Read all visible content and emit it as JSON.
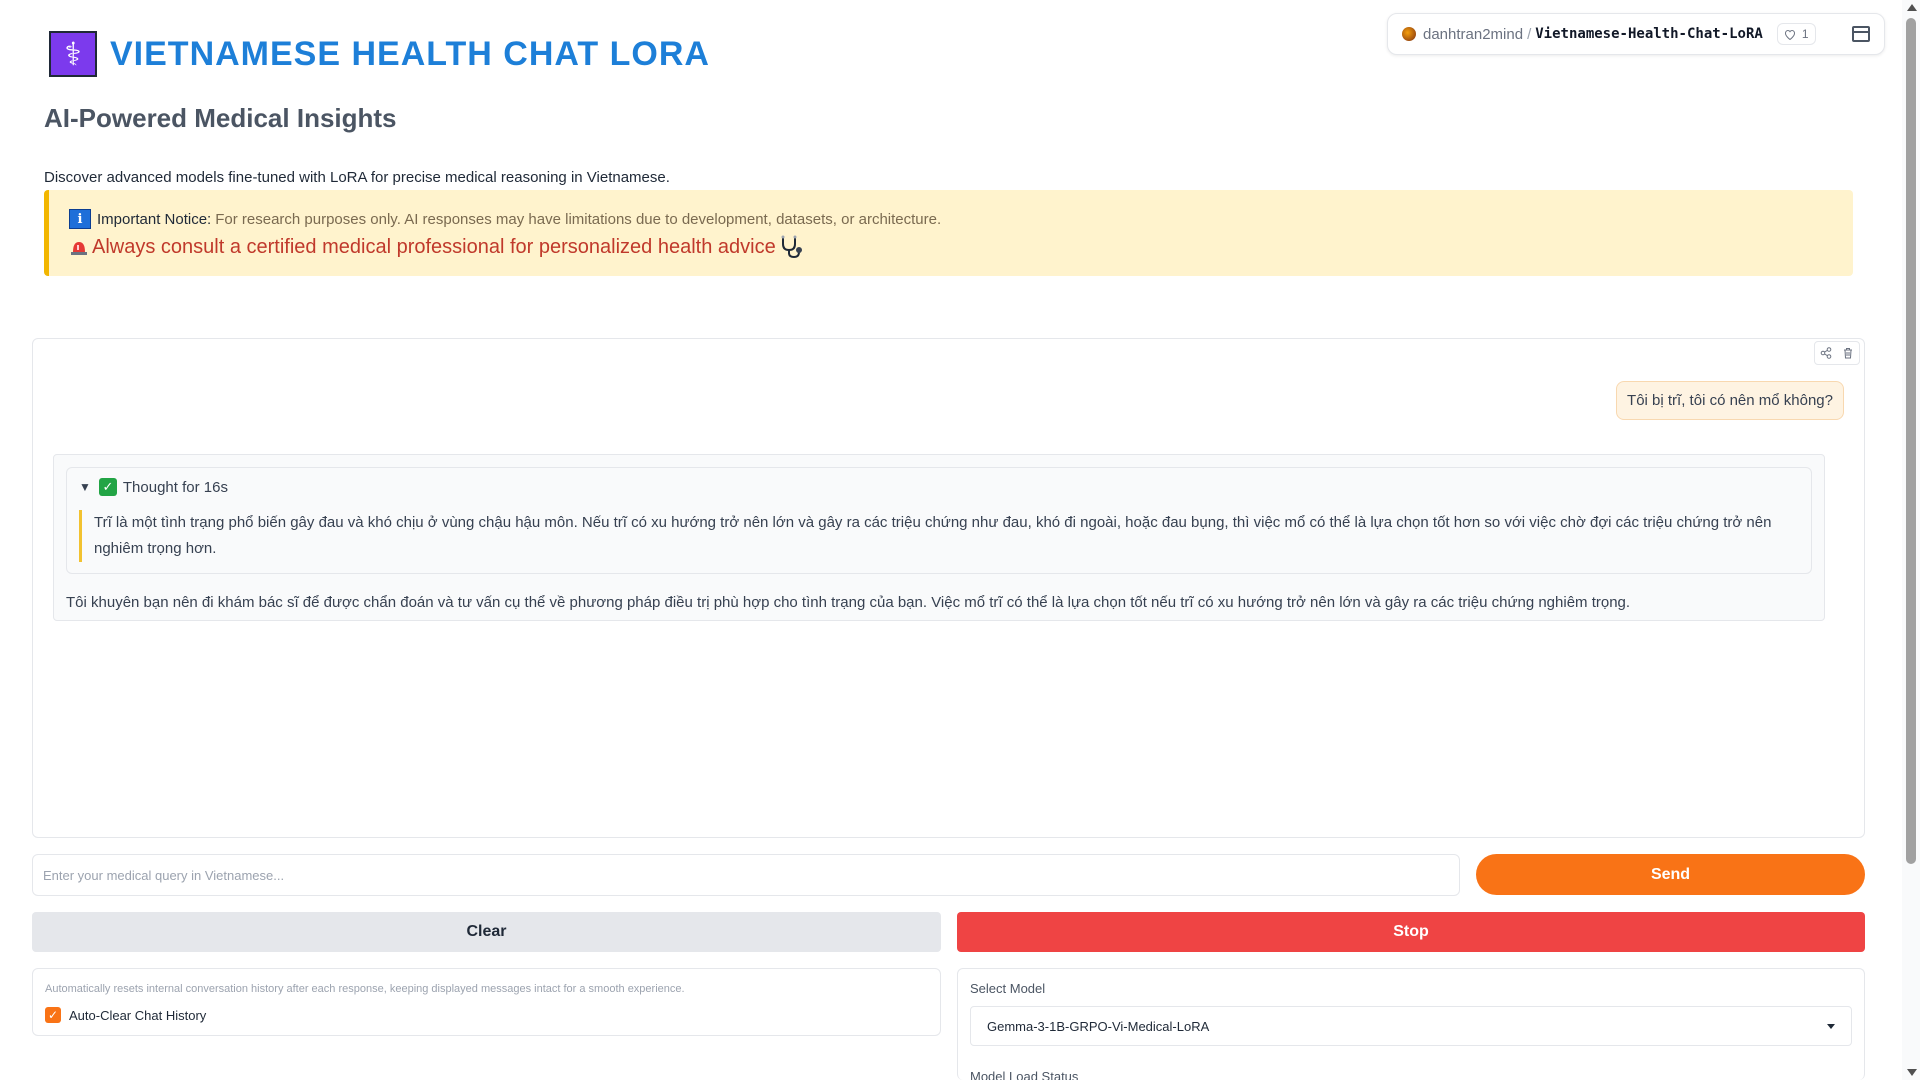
{
  "header": {
    "logo_glyph": "⚕",
    "title": "VIETNAMESE HEALTH CHAT LORA",
    "subtitle": "AI-Powered Medical Insights",
    "description": "Discover advanced models fine-tuned with LoRA for precise medical reasoning in Vietnamese."
  },
  "hf_badge": {
    "owner": "danhtran2mind",
    "separator": "/",
    "repo": "Vietnamese-Health-Chat-LoRA",
    "likes": "1"
  },
  "notice": {
    "info_glyph": "i",
    "label": "Important Notice:",
    "text": "For research purposes only. AI responses may have limitations due to development, datasets, or architecture.",
    "warning": "Always consult a certified medical professional for personalized health advice"
  },
  "chat": {
    "user_message": "Tôi bị trĩ, tôi có nên mổ không?",
    "thought_title": "Thought for 16s",
    "thought_body": "Trĩ là một tình trạng phổ biến gây đau và khó chịu ở vùng chậu hậu môn. Nếu trĩ có xu hướng trở nên lớn và gây ra các triệu chứng như đau, khó đi ngoài, hoặc đau bụng, thì việc mổ có thể là lựa chọn tốt hơn so với việc chờ đợi các triệu chứng trở nên nghiêm trọng hơn.",
    "answer": "Tôi khuyên bạn nên đi khám bác sĩ để được chẩn đoán và tư vấn cụ thể về phương pháp điều trị phù hợp cho tình trạng của bạn. Việc mổ trĩ có thể là lựa chọn tốt nếu trĩ có xu hướng trở nên lớn và gây ra các triệu chứng nghiêm trọng."
  },
  "input": {
    "placeholder": "Enter your medical query in Vietnamese...",
    "value": ""
  },
  "buttons": {
    "send": "Send",
    "clear": "Clear",
    "stop": "Stop"
  },
  "settings": {
    "autoclear_info": "Automatically resets internal conversation history after each response, keeping displayed messages intact for a smooth experience.",
    "autoclear_label": "Auto-Clear Chat History",
    "autoclear_checked": true,
    "model_label": "Select Model",
    "model_selected": "Gemma-3-1B-GRPO-Vi-Medical-LoRA",
    "status_label": "Model Load Status"
  },
  "colors": {
    "title": "#1d7fd8",
    "accent": "#f97316",
    "stop": "#ef4444",
    "notice_bg": "#fff3cd",
    "warning_text": "#c0392b"
  }
}
